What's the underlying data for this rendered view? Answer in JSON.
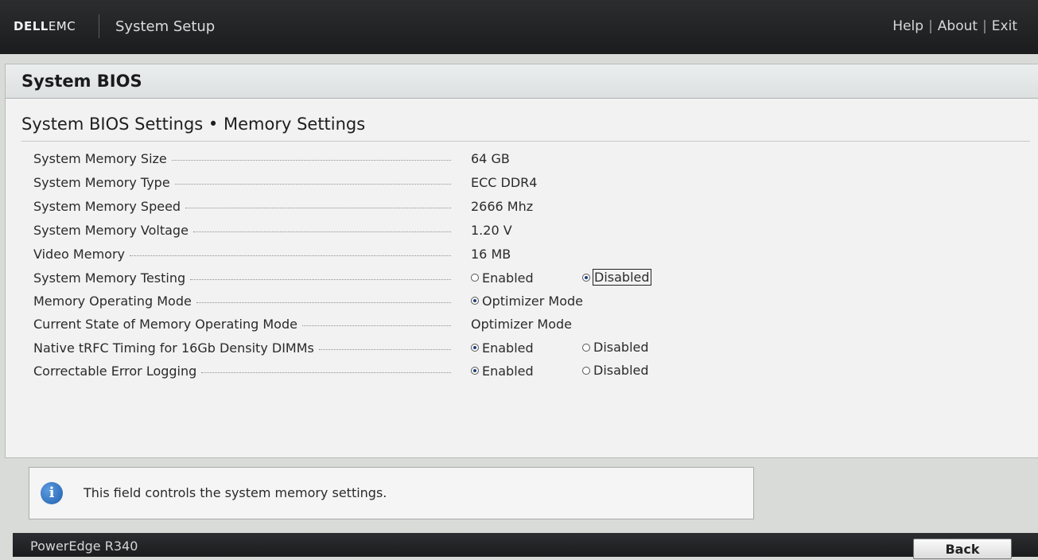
{
  "header": {
    "brand_dell": "DELL",
    "brand_emc": "EMC",
    "title": "System Setup",
    "links": [
      "Help",
      "About",
      "Exit"
    ],
    "link_separator": "|"
  },
  "panel": {
    "title": "System BIOS",
    "section_title": "System BIOS Settings • Memory Settings"
  },
  "settings": [
    {
      "label": "System Memory Size",
      "value": "64 GB"
    },
    {
      "label": "System Memory Type",
      "value": "ECC DDR4"
    },
    {
      "label": "System Memory Speed",
      "value": "2666 Mhz"
    },
    {
      "label": "System Memory Voltage",
      "value": "1.20 V"
    },
    {
      "label": "Video Memory",
      "value": "16 MB"
    },
    {
      "label": "System Memory Testing",
      "options": [
        "Enabled",
        "Disabled"
      ],
      "selected": "Disabled",
      "focused": "Disabled"
    },
    {
      "label": "Memory Operating Mode",
      "options": [
        "Optimizer Mode"
      ],
      "selected": "Optimizer Mode"
    },
    {
      "label": "Current State of Memory Operating Mode",
      "value": "Optimizer Mode"
    },
    {
      "label": "Native tRFC Timing for 16Gb Density DIMMs",
      "options": [
        "Enabled",
        "Disabled"
      ],
      "selected": "Enabled"
    },
    {
      "label": "Correctable Error Logging",
      "options": [
        "Enabled",
        "Disabled"
      ],
      "selected": "Enabled"
    }
  ],
  "help": {
    "icon": "info-icon",
    "text": "This field controls the system memory settings."
  },
  "footer": {
    "model": "PowerEdge R340",
    "back_label": "Back"
  },
  "colors": {
    "topbar": "#1b1c1e",
    "panel_bg": "#f1f2f1",
    "info_icon": "#1f5fae"
  }
}
